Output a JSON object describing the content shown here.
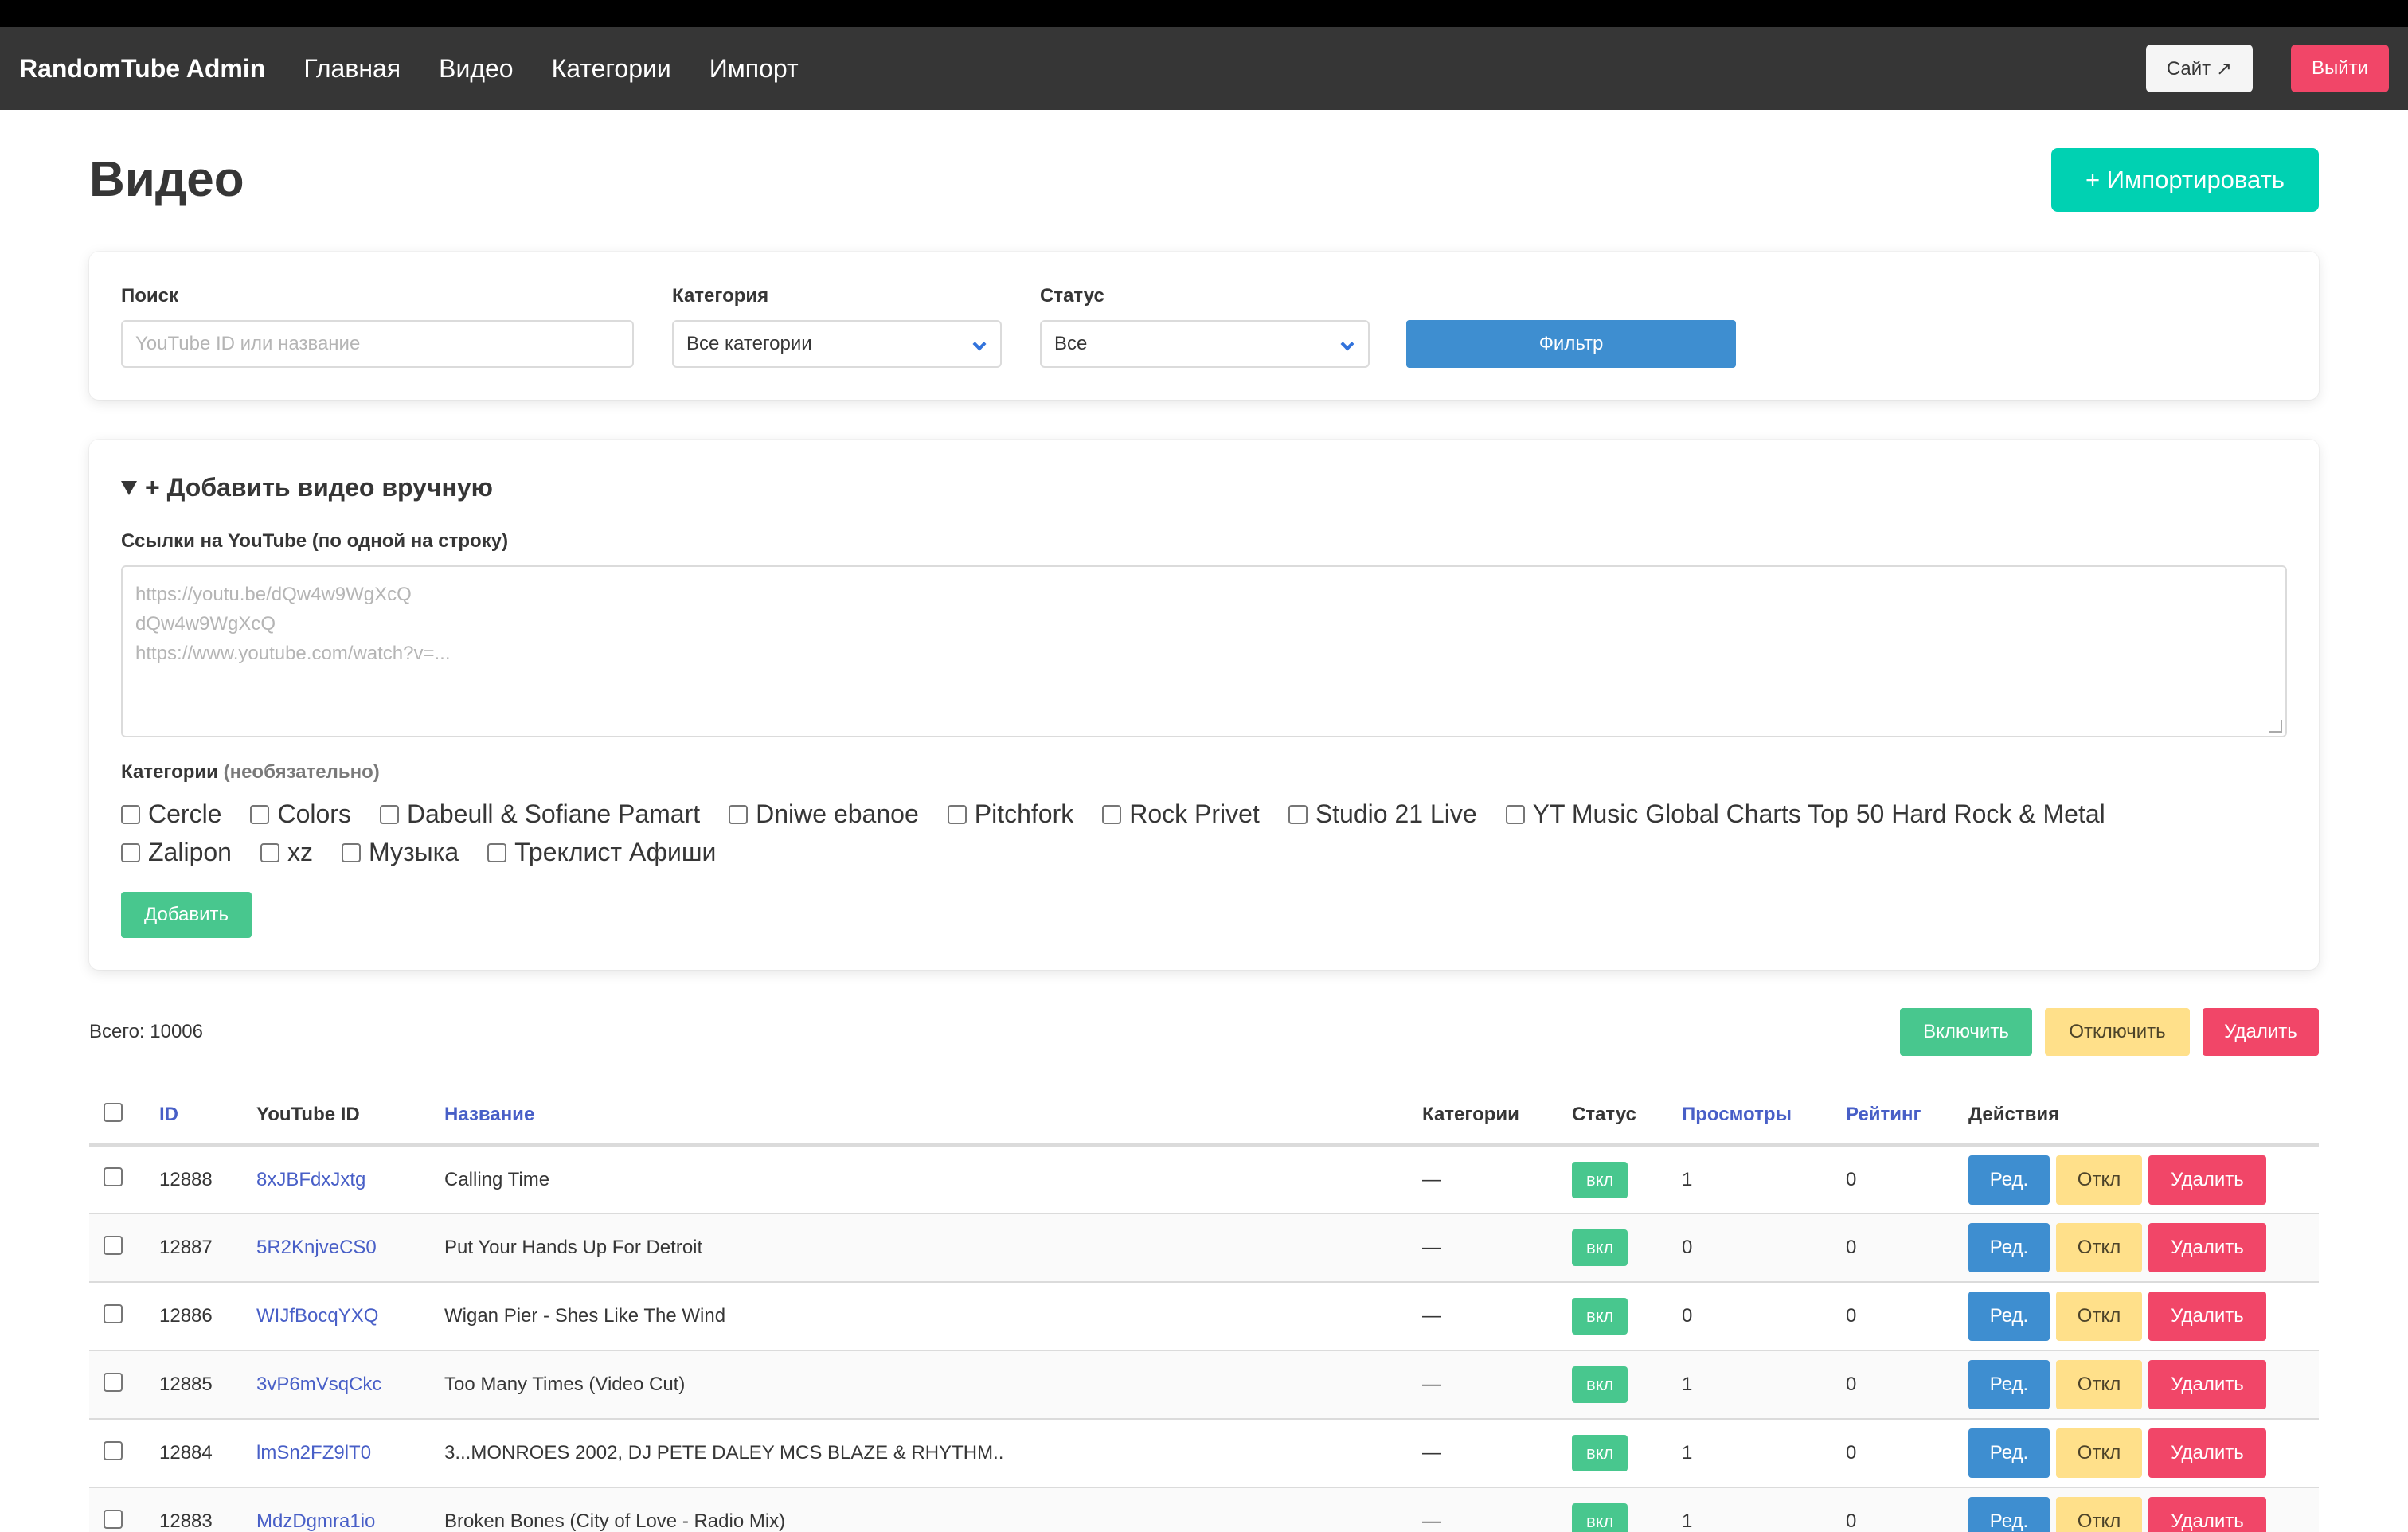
{
  "navbar": {
    "brand": "RandomTube Admin",
    "links": [
      "Главная",
      "Видео",
      "Категории",
      "Импорт"
    ],
    "site_button": "Сайт ↗",
    "logout_button": "Выйти"
  },
  "page": {
    "title": "Видео",
    "import_button": "+ Импортировать"
  },
  "filters": {
    "search_label": "Поиск",
    "search_placeholder": "YouTube ID или название",
    "category_label": "Категория",
    "category_value": "Все категории",
    "status_label": "Статус",
    "status_value": "Все",
    "filter_button": "Фильтр"
  },
  "add_manual": {
    "summary": "+ Добавить видео вручную",
    "links_label": "Ссылки на YouTube (по одной на строку)",
    "placeholder_lines": [
      "https://youtu.be/dQw4w9WgXcQ",
      "dQw4w9WgXcQ",
      "https://www.youtube.com/watch?v=..."
    ],
    "categories_label": "Категории",
    "categories_optional": "(необязательно)",
    "categories_row1": [
      "Cercle",
      "Colors",
      "Dabeull & Sofiane Pamart",
      "Dniwe ebanoe",
      "Pitchfork",
      "Rock Privet",
      "Studio 21 Live",
      "YT Music Global Charts Top 50 Hard Rock & Metal"
    ],
    "categories_row2": [
      "Zalipon",
      "xz",
      "Музыка",
      "Треклист Афиши"
    ],
    "add_button": "Добавить"
  },
  "list": {
    "total": "Всего: 10006",
    "bulk_enable": "Включить",
    "bulk_disable": "Отключить",
    "bulk_delete": "Удалить",
    "columns": {
      "id": "ID",
      "youtube_id": "YouTube ID",
      "title": "Название",
      "categories": "Категории",
      "status": "Статус",
      "views": "Просмотры",
      "rating": "Рейтинг",
      "actions": "Действия"
    },
    "rows": [
      {
        "id": "12888",
        "yt": "8xJBFdxJxtg",
        "title": "Calling Time",
        "cats": "—",
        "status": "вкл",
        "views": "1",
        "rating": "0"
      },
      {
        "id": "12887",
        "yt": "5R2KnjveCS0",
        "title": "Put Your Hands Up For Detroit",
        "cats": "—",
        "status": "вкл",
        "views": "0",
        "rating": "0"
      },
      {
        "id": "12886",
        "yt": "WIJfBocqYXQ",
        "title": "Wigan Pier - Shes Like The Wind",
        "cats": "—",
        "status": "вкл",
        "views": "0",
        "rating": "0"
      },
      {
        "id": "12885",
        "yt": "3vP6mVsqCkc",
        "title": "Too Many Times (Video Cut)",
        "cats": "—",
        "status": "вкл",
        "views": "1",
        "rating": "0"
      },
      {
        "id": "12884",
        "yt": "lmSn2FZ9lT0",
        "title": "3...MONROES 2002, DJ PETE DALEY MCS BLAZE & RHYTHM..",
        "cats": "—",
        "status": "вкл",
        "views": "1",
        "rating": "0"
      },
      {
        "id": "12883",
        "yt": "MdzDgmra1io",
        "title": "Broken Bones (City of Love - Radio Mix)",
        "cats": "—",
        "status": "вкл",
        "views": "1",
        "rating": "0"
      }
    ],
    "row_actions": {
      "edit": "Ред.",
      "disable": "Откл",
      "delete": "Удалить"
    }
  }
}
